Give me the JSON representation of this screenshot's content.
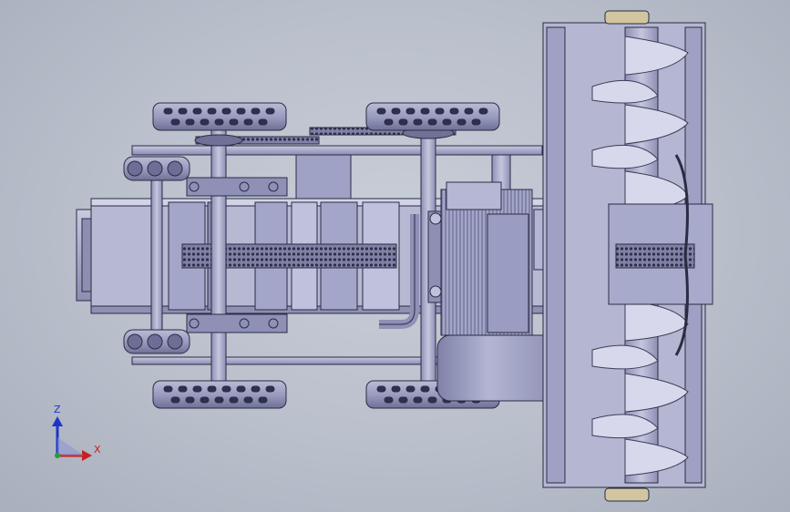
{
  "view": {
    "subject": "cad-model-top-view",
    "background_colors": [
      "#c9ced8",
      "#a9afbc"
    ],
    "model_colors": {
      "body": "#a7a9cc",
      "dark": "#5b5d80",
      "edge": "#2a2c44",
      "light": "#d6d7ea"
    }
  },
  "triad": {
    "z_label": "Z",
    "x_label": "X",
    "z_color": "#1f34c8",
    "x_color": "#c81f1f",
    "origin_color": "#1fa03a"
  }
}
